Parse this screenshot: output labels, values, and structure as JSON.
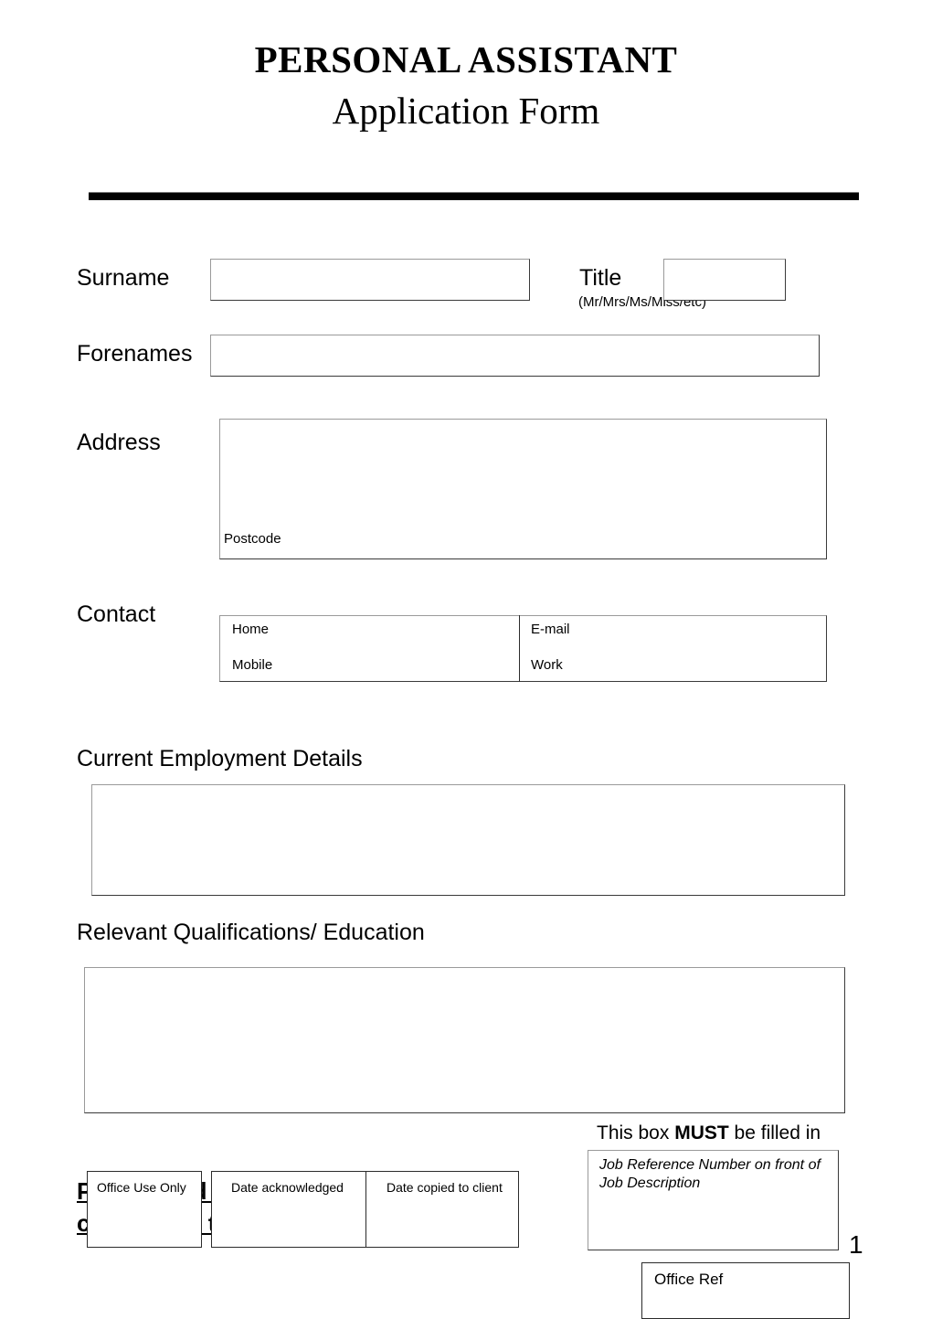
{
  "document": {
    "title_main": "PERSONAL ASSISTANT",
    "title_sub": "Application Form",
    "page_number": "1"
  },
  "fields": {
    "surname_label": "Surname",
    "surname_value": "",
    "title_label": "Title",
    "title_hint": "(Mr/Mrs/Ms/Miss/etc)",
    "title_value": "",
    "forenames_label": "Forenames",
    "forenames_value": "",
    "address_label": "Address",
    "address_value": "",
    "postcode_label": "Postcode",
    "postcode_value": "",
    "contact_label": "Contact",
    "contact_home_label": "Home",
    "contact_home_value": "",
    "contact_mobile_label": "Mobile",
    "contact_mobile_value": "",
    "contact_email_label": "E-mail",
    "contact_email_value": "",
    "contact_work_label": "Work",
    "contact_work_value": ""
  },
  "sections": {
    "employment_heading": "Current Employment Details",
    "employment_value": "",
    "qualifications_heading": "Relevant Qualifications/ Education",
    "qualifications_value": ""
  },
  "footer": {
    "banner_line1": "Please read carefully before",
    "banner_line2": "completing this application",
    "must_prefix": "This box ",
    "must_word": "MUST",
    "must_suffix": " be filled in",
    "jobref_note": "Job Reference Number on front of Job Description",
    "jobref_value": "",
    "office_use_only_label": "Office Use Only",
    "office_use_only_value": "",
    "date_acknowledged_label": "Date acknowledged",
    "date_acknowledged_value": "",
    "date_copied_label": "Date copied to client",
    "date_copied_value": "",
    "office_ref_label": "Office Ref",
    "office_ref_value": ""
  }
}
